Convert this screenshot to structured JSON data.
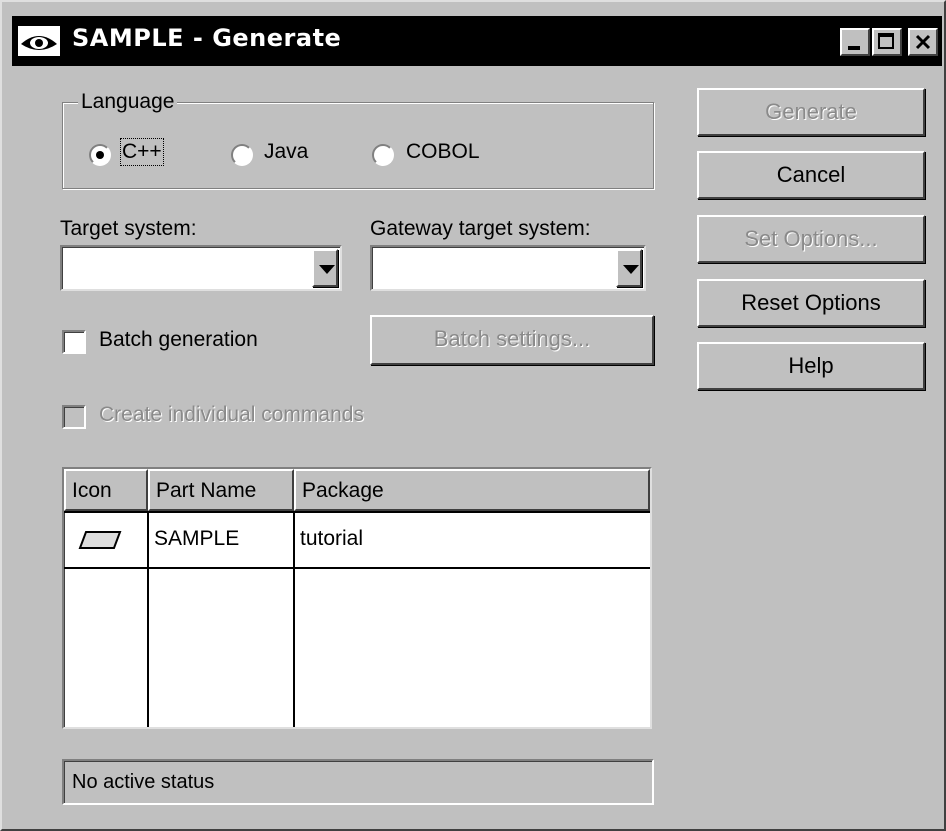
{
  "window": {
    "title": "SAMPLE - Generate",
    "controls": {
      "minimize": "_",
      "maximize": "□",
      "close": "×"
    }
  },
  "language": {
    "legend": "Language",
    "options": [
      {
        "label": "C++",
        "selected": true
      },
      {
        "label": "Java",
        "selected": false
      },
      {
        "label": "COBOL",
        "selected": false
      }
    ]
  },
  "target_system": {
    "label": "Target system:",
    "value": ""
  },
  "gateway_target_system": {
    "label": "Gateway target system:",
    "value": ""
  },
  "batch_generation": {
    "label": "Batch generation",
    "checked": false
  },
  "batch_settings_button": "Batch settings...",
  "create_individual_commands": {
    "label": "Create individual commands",
    "checked": false,
    "enabled": false
  },
  "parts_table": {
    "columns": [
      "Icon",
      "Part Name",
      "Package"
    ],
    "rows": [
      {
        "icon": "part-parallelogram-icon",
        "part_name": "SAMPLE",
        "package": "tutorial"
      }
    ]
  },
  "status": "No active status",
  "buttons": {
    "generate": "Generate",
    "cancel": "Cancel",
    "set_options": "Set Options...",
    "reset_options": "Reset Options",
    "help": "Help"
  },
  "colors": {
    "face": "#c0c0c0",
    "titlebar": "#000000",
    "disabled_text": "#8a8a8a"
  }
}
